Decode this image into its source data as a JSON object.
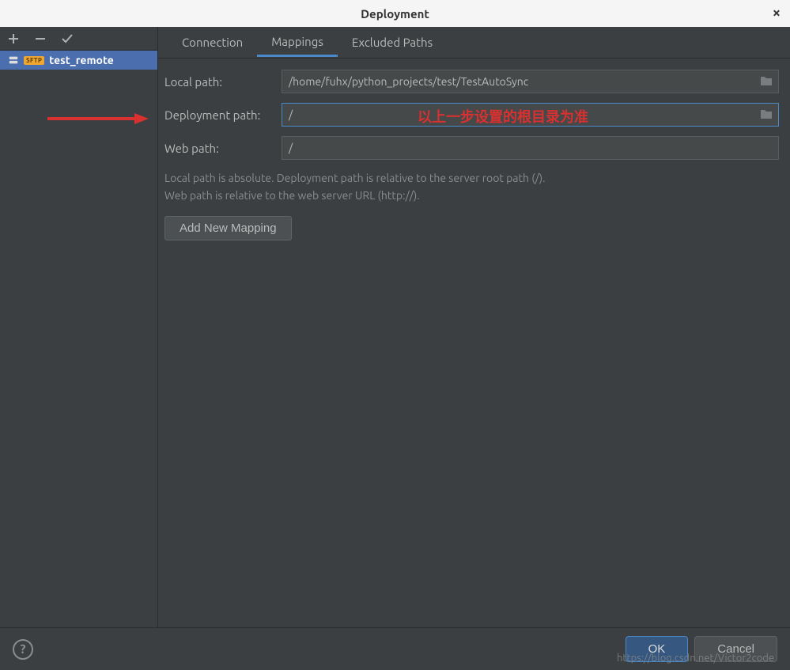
{
  "title": "Deployment",
  "sidebar": {
    "server_name": "test_remote",
    "server_type": "SFTP"
  },
  "tabs": {
    "connection": "Connection",
    "mappings": "Mappings",
    "excluded": "Excluded Paths"
  },
  "form": {
    "local_path_label": "Local path:",
    "local_path_value": "/home/fuhx/python_projects/test/TestAutoSync",
    "deployment_path_label": "Deployment path:",
    "deployment_path_value": "/",
    "web_path_label": "Web path:",
    "web_path_value": "/",
    "help_line1": "Local path is absolute. Deployment path is relative to the server root path (/).",
    "help_line2": "Web path is relative to the web server URL (http://).",
    "add_mapping": "Add New Mapping"
  },
  "footer": {
    "ok": "OK",
    "cancel": "Cancel"
  },
  "annotations": {
    "text": "以上一步设置的根目录为准"
  },
  "watermark": "https://blog.csdn.net/Victor2code"
}
